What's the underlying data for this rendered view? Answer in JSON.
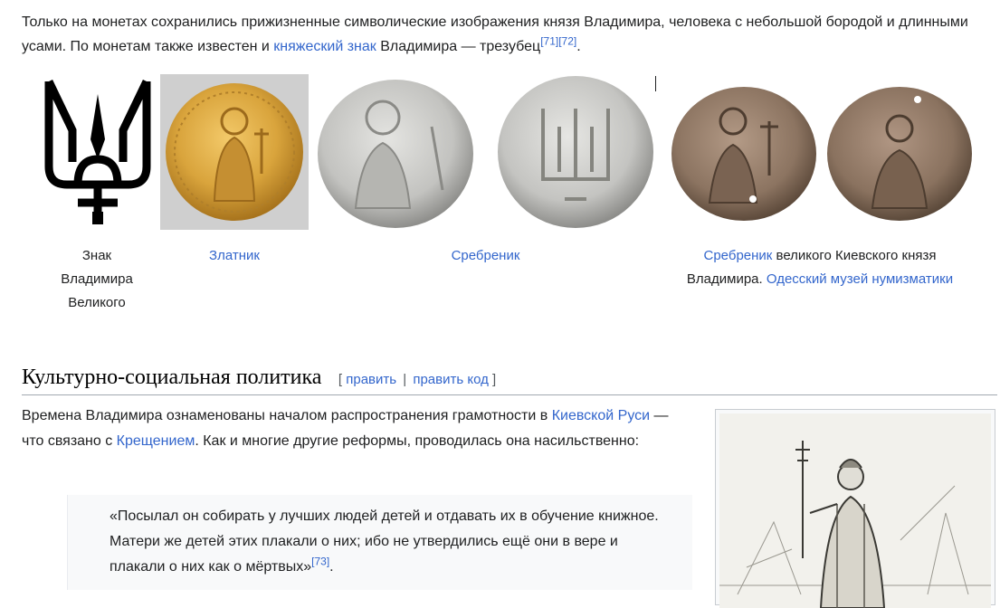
{
  "intro": {
    "text1": "Только на монетах сохранились прижизненные символические изображения князя Владимира, человека с небольшой бородой и длинными усами. По монетам также известен и ",
    "link": "княжеский знак",
    "text2": " Владимира — трезубец",
    "ref1": "[71]",
    "ref2": "[72]",
    "end": "."
  },
  "gallery": {
    "caption1": {
      "l1": "Знак",
      "l2": "Владимира",
      "l3": "Великого"
    },
    "caption2": {
      "link": "Златник"
    },
    "caption3": {
      "link": "Сребреник"
    },
    "caption4": {
      "link": "Сребреник",
      "text1": " великого Киевского князя",
      "text2": "Владимира. ",
      "link2": "Одесский музей нумизматики"
    }
  },
  "section": {
    "title": "Культурно-социальная политика",
    "bracket_open": "[",
    "edit": "править",
    "sep": "|",
    "edit_code": "править код",
    "bracket_close": "]"
  },
  "para": {
    "t1": "Времена Владимира ознаменованы началом распространения грамотности в ",
    "link1": "Киевской Руси",
    "t2": " — что связано с ",
    "link2": "Крещением",
    "t3": ". Как и многие другие реформы, проводилась она насильственно:"
  },
  "quote": {
    "text": "«Посылал он собирать у лучших людей детей и отдавать их в обучение книжное. Матери же детей этих плакали о них; ибо не утвердились ещё они в вере и плакали о них как о мёртвых»",
    "ref": "[73]",
    "end": "."
  },
  "colors": {
    "link": "#3366cc",
    "text": "#202122",
    "gold": "#d9a43c",
    "silver": "#c9c9c6",
    "bronze": "#8c7461"
  }
}
